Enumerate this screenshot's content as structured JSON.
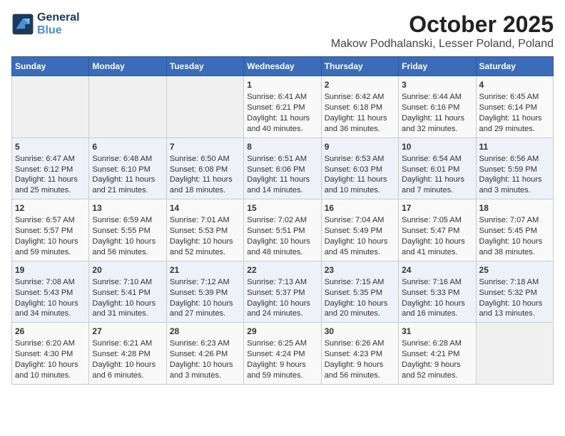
{
  "header": {
    "logo_line1": "General",
    "logo_line2": "Blue",
    "title": "October 2025",
    "subtitle": "Makow Podhalanski, Lesser Poland, Poland"
  },
  "weekdays": [
    "Sunday",
    "Monday",
    "Tuesday",
    "Wednesday",
    "Thursday",
    "Friday",
    "Saturday"
  ],
  "weeks": [
    [
      {
        "day": "",
        "content": ""
      },
      {
        "day": "",
        "content": ""
      },
      {
        "day": "",
        "content": ""
      },
      {
        "day": "1",
        "content": "Sunrise: 6:41 AM\nSunset: 6:21 PM\nDaylight: 11 hours and 40 minutes."
      },
      {
        "day": "2",
        "content": "Sunrise: 6:42 AM\nSunset: 6:18 PM\nDaylight: 11 hours and 36 minutes."
      },
      {
        "day": "3",
        "content": "Sunrise: 6:44 AM\nSunset: 6:16 PM\nDaylight: 11 hours and 32 minutes."
      },
      {
        "day": "4",
        "content": "Sunrise: 6:45 AM\nSunset: 6:14 PM\nDaylight: 11 hours and 29 minutes."
      }
    ],
    [
      {
        "day": "5",
        "content": "Sunrise: 6:47 AM\nSunset: 6:12 PM\nDaylight: 11 hours and 25 minutes."
      },
      {
        "day": "6",
        "content": "Sunrise: 6:48 AM\nSunset: 6:10 PM\nDaylight: 11 hours and 21 minutes."
      },
      {
        "day": "7",
        "content": "Sunrise: 6:50 AM\nSunset: 6:08 PM\nDaylight: 11 hours and 18 minutes."
      },
      {
        "day": "8",
        "content": "Sunrise: 6:51 AM\nSunset: 6:06 PM\nDaylight: 11 hours and 14 minutes."
      },
      {
        "day": "9",
        "content": "Sunrise: 6:53 AM\nSunset: 6:03 PM\nDaylight: 11 hours and 10 minutes."
      },
      {
        "day": "10",
        "content": "Sunrise: 6:54 AM\nSunset: 6:01 PM\nDaylight: 11 hours and 7 minutes."
      },
      {
        "day": "11",
        "content": "Sunrise: 6:56 AM\nSunset: 5:59 PM\nDaylight: 11 hours and 3 minutes."
      }
    ],
    [
      {
        "day": "12",
        "content": "Sunrise: 6:57 AM\nSunset: 5:57 PM\nDaylight: 10 hours and 59 minutes."
      },
      {
        "day": "13",
        "content": "Sunrise: 6:59 AM\nSunset: 5:55 PM\nDaylight: 10 hours and 56 minutes."
      },
      {
        "day": "14",
        "content": "Sunrise: 7:01 AM\nSunset: 5:53 PM\nDaylight: 10 hours and 52 minutes."
      },
      {
        "day": "15",
        "content": "Sunrise: 7:02 AM\nSunset: 5:51 PM\nDaylight: 10 hours and 48 minutes."
      },
      {
        "day": "16",
        "content": "Sunrise: 7:04 AM\nSunset: 5:49 PM\nDaylight: 10 hours and 45 minutes."
      },
      {
        "day": "17",
        "content": "Sunrise: 7:05 AM\nSunset: 5:47 PM\nDaylight: 10 hours and 41 minutes."
      },
      {
        "day": "18",
        "content": "Sunrise: 7:07 AM\nSunset: 5:45 PM\nDaylight: 10 hours and 38 minutes."
      }
    ],
    [
      {
        "day": "19",
        "content": "Sunrise: 7:08 AM\nSunset: 5:43 PM\nDaylight: 10 hours and 34 minutes."
      },
      {
        "day": "20",
        "content": "Sunrise: 7:10 AM\nSunset: 5:41 PM\nDaylight: 10 hours and 31 minutes."
      },
      {
        "day": "21",
        "content": "Sunrise: 7:12 AM\nSunset: 5:39 PM\nDaylight: 10 hours and 27 minutes."
      },
      {
        "day": "22",
        "content": "Sunrise: 7:13 AM\nSunset: 5:37 PM\nDaylight: 10 hours and 24 minutes."
      },
      {
        "day": "23",
        "content": "Sunrise: 7:15 AM\nSunset: 5:35 PM\nDaylight: 10 hours and 20 minutes."
      },
      {
        "day": "24",
        "content": "Sunrise: 7:16 AM\nSunset: 5:33 PM\nDaylight: 10 hours and 16 minutes."
      },
      {
        "day": "25",
        "content": "Sunrise: 7:18 AM\nSunset: 5:32 PM\nDaylight: 10 hours and 13 minutes."
      }
    ],
    [
      {
        "day": "26",
        "content": "Sunrise: 6:20 AM\nSunset: 4:30 PM\nDaylight: 10 hours and 10 minutes."
      },
      {
        "day": "27",
        "content": "Sunrise: 6:21 AM\nSunset: 4:28 PM\nDaylight: 10 hours and 6 minutes."
      },
      {
        "day": "28",
        "content": "Sunrise: 6:23 AM\nSunset: 4:26 PM\nDaylight: 10 hours and 3 minutes."
      },
      {
        "day": "29",
        "content": "Sunrise: 6:25 AM\nSunset: 4:24 PM\nDaylight: 9 hours and 59 minutes."
      },
      {
        "day": "30",
        "content": "Sunrise: 6:26 AM\nSunset: 4:23 PM\nDaylight: 9 hours and 56 minutes."
      },
      {
        "day": "31",
        "content": "Sunrise: 6:28 AM\nSunset: 4:21 PM\nDaylight: 9 hours and 52 minutes."
      },
      {
        "day": "",
        "content": ""
      }
    ]
  ]
}
